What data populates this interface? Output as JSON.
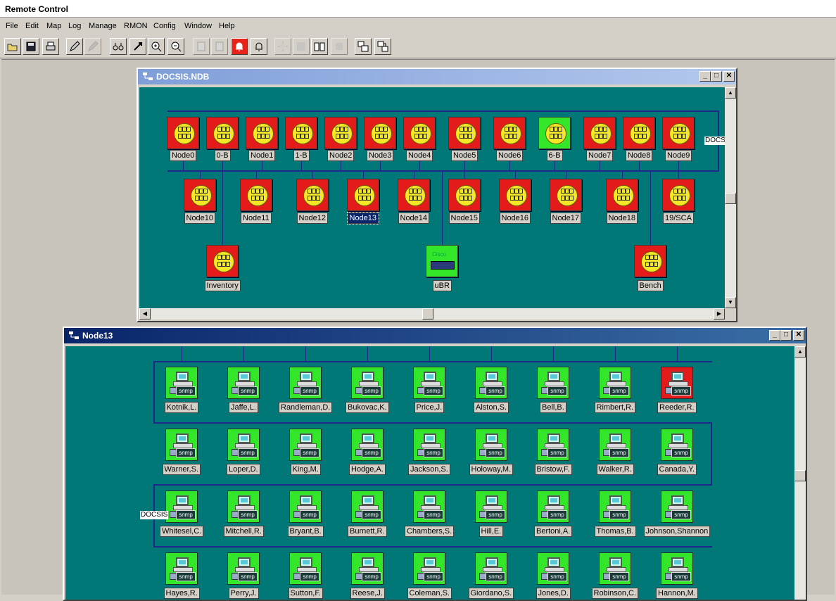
{
  "app": {
    "title": "Remote Control"
  },
  "menu": [
    "File",
    "Edit",
    "Map",
    "Log",
    "Manage",
    "RMON",
    "Config",
    "Window",
    "Help"
  ],
  "toolbar": {
    "buttons": [
      "open-icon",
      "save-icon",
      "print-icon",
      "pencil-icon",
      "pencil-disabled-icon",
      "binoculars-icon",
      "link-icon",
      "zoom-in-icon",
      "zoom-out-icon",
      "doc-a-icon",
      "doc-b-icon",
      "alarm-bell-icon",
      "bell-icon",
      "burst-icon",
      "grid-icon",
      "book-icon",
      "doc-disabled-icon",
      "tile-icon",
      "cascade-icon"
    ]
  },
  "docsis_window": {
    "title": "DOCSIS.NDB",
    "side_label": "DOCS",
    "row1": [
      {
        "label": "Node0",
        "status": "red"
      },
      {
        "label": "0-B",
        "status": "red"
      },
      {
        "label": "Node1",
        "status": "red"
      },
      {
        "label": "1-B",
        "status": "red"
      },
      {
        "label": "Node2",
        "status": "red"
      },
      {
        "label": "Node3",
        "status": "red"
      },
      {
        "label": "Node4",
        "status": "red"
      },
      {
        "label": "Node5",
        "status": "red"
      },
      {
        "label": "Node6",
        "status": "red"
      },
      {
        "label": "6-B",
        "status": "green"
      },
      {
        "label": "Node7",
        "status": "red"
      },
      {
        "label": "Node8",
        "status": "red"
      },
      {
        "label": "Node9",
        "status": "red"
      }
    ],
    "row2": [
      {
        "label": "Node10",
        "status": "red"
      },
      {
        "label": "Node11",
        "status": "red"
      },
      {
        "label": "Node12",
        "status": "red"
      },
      {
        "label": "Node13",
        "status": "red",
        "selected": true
      },
      {
        "label": "Node14",
        "status": "red"
      },
      {
        "label": "Node15",
        "status": "red"
      },
      {
        "label": "Node16",
        "status": "red"
      },
      {
        "label": "Node17",
        "status": "red"
      },
      {
        "label": "Node18",
        "status": "red"
      },
      {
        "label": "19/SCA",
        "status": "red"
      }
    ],
    "row3": [
      {
        "label": "Inventory",
        "status": "red",
        "kind": "hub"
      },
      {
        "label": "uBR",
        "status": "green",
        "kind": "router",
        "brand": "Cisco"
      },
      {
        "label": "Bench",
        "status": "red",
        "kind": "hub"
      }
    ]
  },
  "node13_window": {
    "title": "Node13",
    "side_label": "DOCSIS",
    "badge": "snmp",
    "rows": [
      [
        {
          "label": "Kotnik,L.",
          "status": "green"
        },
        {
          "label": "Jaffe,L.",
          "status": "green"
        },
        {
          "label": "Randleman,D.",
          "status": "green"
        },
        {
          "label": "Bukovac,K.",
          "status": "green"
        },
        {
          "label": "Price,J.",
          "status": "green"
        },
        {
          "label": "Alston,S.",
          "status": "green"
        },
        {
          "label": "Bell,B.",
          "status": "green"
        },
        {
          "label": "Rimbert,R.",
          "status": "green"
        },
        {
          "label": "Reeder,R.",
          "status": "red"
        }
      ],
      [
        {
          "label": "Warner,S.",
          "status": "green"
        },
        {
          "label": "Loper,D.",
          "status": "green"
        },
        {
          "label": "King,M.",
          "status": "green"
        },
        {
          "label": "Hodge,A.",
          "status": "green"
        },
        {
          "label": "Jackson,S.",
          "status": "green"
        },
        {
          "label": "Holoway,M.",
          "status": "green"
        },
        {
          "label": "Bristow,F.",
          "status": "green"
        },
        {
          "label": "Walker,R.",
          "status": "green"
        },
        {
          "label": "Canada,Y.",
          "status": "green"
        }
      ],
      [
        {
          "label": "Whitesel,C.",
          "status": "green"
        },
        {
          "label": "Mitchell,R.",
          "status": "green"
        },
        {
          "label": "Bryant,B.",
          "status": "green"
        },
        {
          "label": "Burnett,R.",
          "status": "green"
        },
        {
          "label": "Chambers,S.",
          "status": "green"
        },
        {
          "label": "Hill,E.",
          "status": "green"
        },
        {
          "label": "Bertoni,A.",
          "status": "green"
        },
        {
          "label": "Thomas,B.",
          "status": "green"
        },
        {
          "label": "Johnson,Shannon",
          "status": "green"
        }
      ],
      [
        {
          "label": "Hayes,R.",
          "status": "green"
        },
        {
          "label": "Perry,J.",
          "status": "green"
        },
        {
          "label": "Sutton,F.",
          "status": "green"
        },
        {
          "label": "Reese,J.",
          "status": "green"
        },
        {
          "label": "Coleman,S.",
          "status": "green"
        },
        {
          "label": "Giordano,S.",
          "status": "green"
        },
        {
          "label": "Jones,D.",
          "status": "green"
        },
        {
          "label": "Robinson,C.",
          "status": "green"
        },
        {
          "label": "Hannon,M.",
          "status": "green"
        }
      ]
    ]
  },
  "colors": {
    "map_bg": "#007878",
    "alarm": "#e31b1b",
    "ok": "#34e62a",
    "bus": "#1e2a8a"
  }
}
